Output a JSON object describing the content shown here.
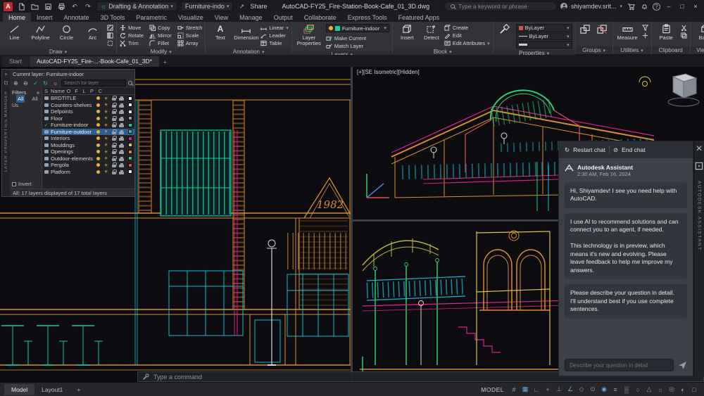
{
  "glyphs": {
    "caret": "▾",
    "close": "×",
    "minimize": "–",
    "maximize": "□",
    "share_arrow": "↗",
    "undo": "↶",
    "redo": "↷",
    "restart": "↻",
    "end_chat": "⊘",
    "new_layer": "⊕",
    "delete_layer": "⊖",
    "set_current": "✓",
    "refresh": "↻",
    "settings": "☼",
    "collapse": "«",
    "freeze_sun": "☀",
    "help": "?",
    "plus": "+",
    "panel": "⊡",
    "text_tool": "A",
    "grid": "#",
    "snap": "▦",
    "infer": "∟",
    "dyn_input": "+",
    "ortho": "⊥",
    "polar": "∠",
    "isodraft": "◇",
    "osnap_track": "⊙",
    "osnap": "◉",
    "lineweight": "≡",
    "transparency": "▒",
    "cycling": "○",
    "annotation": "△",
    "workspace": "☼",
    "isolate": "◎",
    "graphics": "◐",
    "clean_screen": "□"
  },
  "colors": {
    "accent_teal": "#17c9a4",
    "selection_blue": "#2d5c8e",
    "bylayer_swatch": "#d04f4f",
    "bulb_on": "#e8b339"
  },
  "titlebar": {
    "logo_text": "A",
    "workspace": "Drafting & Annotation",
    "qat_layer": "Furniture-indo",
    "share": "Share",
    "title": "AutoCAD-FY25_Fire-Station-Book-Cafe_01_3D.dwg",
    "search_placeholder": "Type a keyword or phrase",
    "user": "shiyamdev.srit..."
  },
  "ribbon": {
    "tabs": [
      {
        "label": "Home",
        "active": true
      },
      {
        "label": "Insert"
      },
      {
        "label": "Annotate"
      },
      {
        "label": "3D Tools"
      },
      {
        "label": "Parametric"
      },
      {
        "label": "Visualize"
      },
      {
        "label": "View"
      },
      {
        "label": "Manage"
      },
      {
        "label": "Output"
      },
      {
        "label": "Collaborate"
      },
      {
        "label": "Express Tools"
      },
      {
        "label": "Featured Apps"
      }
    ],
    "draw": {
      "label": "Draw",
      "buttons": [
        "Line",
        "Polyline",
        "Circle",
        "Arc"
      ]
    },
    "modify": {
      "label": "Modify",
      "buttons": [
        "Move",
        "Rotate",
        "Trim",
        "Copy",
        "Mirror",
        "Fillet",
        "Stretch",
        "Scale",
        "Array"
      ]
    },
    "annotation": {
      "label": "Annotation",
      "big": [
        "Text",
        "Dimension"
      ],
      "small": [
        "Linear",
        "Leader",
        "Table"
      ]
    },
    "layers": {
      "label": "Layers",
      "main": "Layer Properties",
      "current": "Furniture-indoor",
      "small": [
        "Make Current",
        "Match Layer"
      ]
    },
    "block": {
      "label": "Block",
      "main": "Insert",
      "detect": "Detect",
      "small": [
        "Create",
        "Edit",
        "Edit Attributes"
      ]
    },
    "properties": {
      "label": "Properties",
      "values": [
        "ByLayer",
        "ByLayer"
      ]
    },
    "groups": {
      "label": "Groups"
    },
    "utilities": {
      "label": "Utilities",
      "main": "Measure"
    },
    "clipboard": {
      "label": "Clipboard",
      "main": "Paste"
    },
    "view": {
      "label": "View",
      "main": "Base"
    }
  },
  "filetabs": {
    "start": "Start",
    "drawing": "AutoCAD-FY25_Fire-...-Book-Cafe_01_3D*"
  },
  "layer_palette": {
    "vertical_label": "LAYER PROPERTIES MANAGER",
    "current_label": "Current layer: Furniture-indoor",
    "search_placeholder": "Search for layer",
    "filters_label": "Filters",
    "filters": [
      {
        "label": "All",
        "selected": true
      },
      {
        "label": "All Us"
      }
    ],
    "columns": [
      "S",
      "Name",
      "O",
      "F",
      "L",
      "P",
      "C"
    ],
    "layers": [
      {
        "name": "BRDTITLE",
        "color": "#e8e8e8"
      },
      {
        "name": "Counters-shelves",
        "color": "#e8e8e8"
      },
      {
        "name": "Defpoints",
        "color": "#e8e8e8"
      },
      {
        "name": "Floor",
        "color": "#9a9aa0"
      },
      {
        "name": "Furniture-indoor",
        "color": "#17c9a4",
        "current": true
      },
      {
        "name": "Furniture-outdoor",
        "color": "#17c9a4",
        "selected": true
      },
      {
        "name": "Interiors",
        "color": "#e0218a"
      },
      {
        "name": "Mouldings",
        "color": "#d9c54a"
      },
      {
        "name": "Openings",
        "color": "#d98e2b"
      },
      {
        "name": "Outdoor-elements",
        "color": "#2ecc71"
      },
      {
        "name": "Pergola",
        "color": "#e05252"
      },
      {
        "name": "Platform",
        "color": "#e8e8e8"
      }
    ],
    "invert_label": "Invert",
    "status": "All: 17 layers displayed of 17 total layers"
  },
  "canvas": {
    "viewport_label": "[+][SE Isometric][Hidden]",
    "facade_year": "1982"
  },
  "assistant": {
    "restart": "Restart chat",
    "end": "End chat",
    "bot_name": "Autodesk Assistant",
    "timestamp": "2:30 AM, Feb 16, 2024",
    "messages": [
      "Hi, Shiyamdev! I see you need help with AutoCAD.",
      "I use AI to recommend solutions and can connect you to an agent, if needed.\n\nThis technology is in preview, which means it's new and evolving. Please leave feedback to help me improve my answers.",
      "Please describe your question in detail. I'll understand best if you use complete sentences."
    ],
    "input_placeholder": "Describe your question in detail",
    "vertical_label": "AUTODESK ASSISTANT"
  },
  "commandbar": {
    "placeholder": "Type a command"
  },
  "statusbar": {
    "model_tab": "Model",
    "layout_tab": "Layout1",
    "new_layout": "+",
    "mode": "MODEL"
  }
}
